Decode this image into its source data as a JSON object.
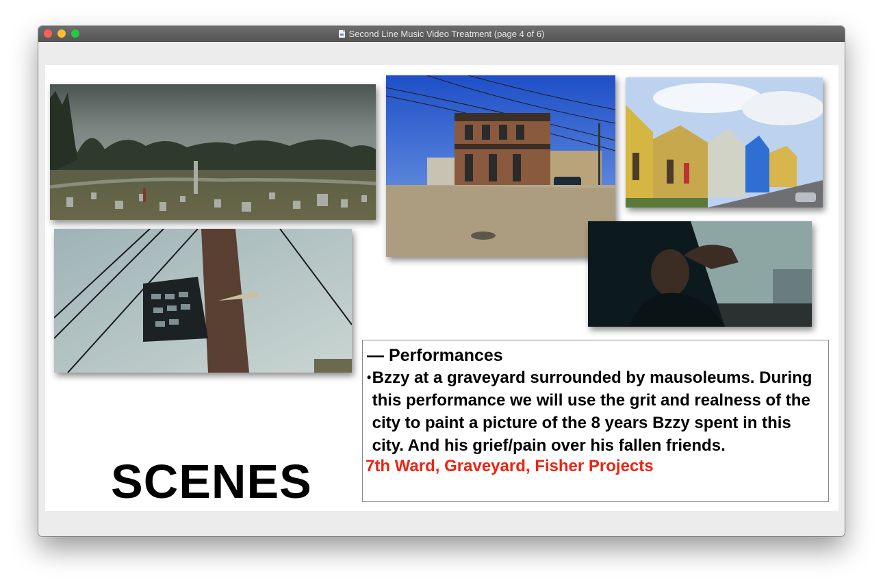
{
  "window": {
    "title": "Second Line Music Video Treatment (page 4 of 6)",
    "icon": "document-icon"
  },
  "slide": {
    "heading": "— Performances",
    "bullet_symbol": "•",
    "bullet_text": "Bzzy at a graveyard surrounded by mausoleums. During this performance we will use the grit and realness of the city to paint a picture of the 8 years Bzzy spent in this city. And his grief/pain over his fallen friends.",
    "locations": "7th Ward, Graveyard, Fisher Projects",
    "locations_color": "#f0220e",
    "scenes_label": "SCENES"
  },
  "photos": [
    {
      "name": "graveyard-photo",
      "subject": "cemetery under overcast sky"
    },
    {
      "name": "corner-house-photo",
      "subject": "two-story corner building with power lines"
    },
    {
      "name": "shotgun-houses-photo",
      "subject": "row of colorful shotgun houses"
    },
    {
      "name": "utility-pole-photo",
      "subject": "milk crate nailed to utility pole"
    },
    {
      "name": "man-in-car-photo",
      "subject": "man sitting in car looking out window"
    }
  ]
}
